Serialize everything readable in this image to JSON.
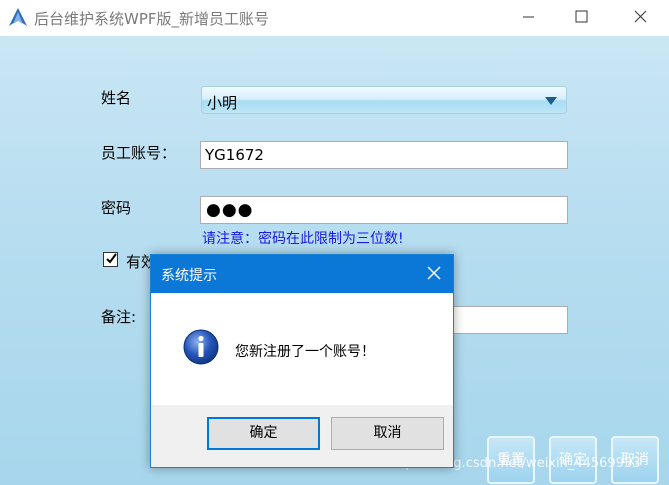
{
  "window": {
    "title": "后台维护系统WPF版_新增员工账号"
  },
  "form": {
    "name_label": "姓名",
    "name_value": "小明",
    "id_label": "员工账号：",
    "id_value": "YG1672",
    "password_label": "密码",
    "password_dots": "●●●",
    "password_hint": "请注意：密码在此限制为三位数!",
    "valid_label": "有效",
    "valid_checked": true,
    "remark_label": "备注:",
    "remark_value": ""
  },
  "buttons": {
    "reset": "重置",
    "confirm": "确定",
    "cancel": "取消"
  },
  "watermark": "https://blog.csdn.net/weixin_44569933",
  "dialog": {
    "title": "系统提示",
    "message": "您新注册了一个账号！",
    "ok": "确定",
    "cancel": "取消"
  },
  "colors": {
    "dialog_title_bg": "#0b78d7",
    "hint_text": "#1a1ae0",
    "client_bg": "#b6ddf0"
  }
}
